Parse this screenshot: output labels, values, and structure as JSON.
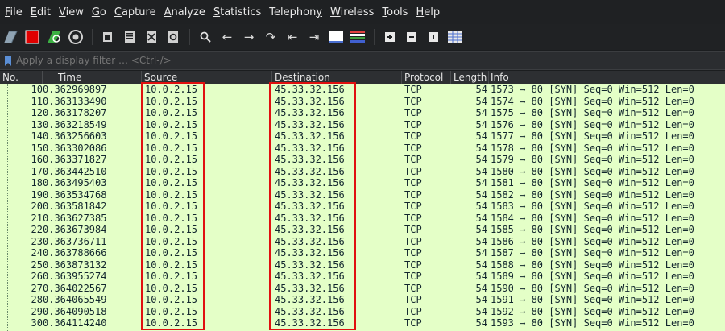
{
  "menu": [
    {
      "label": "File",
      "accel": "F",
      "rest": "ile"
    },
    {
      "label": "Edit",
      "accel": "E",
      "rest": "dit"
    },
    {
      "label": "View",
      "accel": "V",
      "rest": "iew"
    },
    {
      "label": "Go",
      "accel": "G",
      "rest": "o"
    },
    {
      "label": "Capture",
      "accel": "C",
      "rest": "apture"
    },
    {
      "label": "Analyze",
      "accel": "A",
      "rest": "nalyze"
    },
    {
      "label": "Statistics",
      "accel": "S",
      "rest": "tatistics"
    },
    {
      "label": "Telephony",
      "accel": "y",
      "rest": ""
    },
    {
      "label": "Wireless",
      "accel": "W",
      "rest": "ireless"
    },
    {
      "label": "Tools",
      "accel": "T",
      "rest": "ools"
    },
    {
      "label": "Help",
      "accel": "H",
      "rest": "elp"
    }
  ],
  "filter": {
    "placeholder": "Apply a display filter … <Ctrl-/>"
  },
  "columns": {
    "no": "No.",
    "time": "Time",
    "source": "Source",
    "destination": "Destination",
    "protocol": "Protocol",
    "length": "Length",
    "info": "Info"
  },
  "packets": [
    {
      "no": "10",
      "time": "0.362969897",
      "source": "10.0.2.15",
      "destination": "45.33.32.156",
      "protocol": "TCP",
      "length": "54",
      "info": "1573 → 80 [SYN] Seq=0 Win=512 Len=0"
    },
    {
      "no": "11",
      "time": "0.363133490",
      "source": "10.0.2.15",
      "destination": "45.33.32.156",
      "protocol": "TCP",
      "length": "54",
      "info": "1574 → 80 [SYN] Seq=0 Win=512 Len=0"
    },
    {
      "no": "12",
      "time": "0.363178207",
      "source": "10.0.2.15",
      "destination": "45.33.32.156",
      "protocol": "TCP",
      "length": "54",
      "info": "1575 → 80 [SYN] Seq=0 Win=512 Len=0"
    },
    {
      "no": "13",
      "time": "0.363218549",
      "source": "10.0.2.15",
      "destination": "45.33.32.156",
      "protocol": "TCP",
      "length": "54",
      "info": "1576 → 80 [SYN] Seq=0 Win=512 Len=0"
    },
    {
      "no": "14",
      "time": "0.363256603",
      "source": "10.0.2.15",
      "destination": "45.33.32.156",
      "protocol": "TCP",
      "length": "54",
      "info": "1577 → 80 [SYN] Seq=0 Win=512 Len=0"
    },
    {
      "no": "15",
      "time": "0.363302086",
      "source": "10.0.2.15",
      "destination": "45.33.32.156",
      "protocol": "TCP",
      "length": "54",
      "info": "1578 → 80 [SYN] Seq=0 Win=512 Len=0"
    },
    {
      "no": "16",
      "time": "0.363371827",
      "source": "10.0.2.15",
      "destination": "45.33.32.156",
      "protocol": "TCP",
      "length": "54",
      "info": "1579 → 80 [SYN] Seq=0 Win=512 Len=0"
    },
    {
      "no": "17",
      "time": "0.363442510",
      "source": "10.0.2.15",
      "destination": "45.33.32.156",
      "protocol": "TCP",
      "length": "54",
      "info": "1580 → 80 [SYN] Seq=0 Win=512 Len=0"
    },
    {
      "no": "18",
      "time": "0.363495403",
      "source": "10.0.2.15",
      "destination": "45.33.32.156",
      "protocol": "TCP",
      "length": "54",
      "info": "1581 → 80 [SYN] Seq=0 Win=512 Len=0"
    },
    {
      "no": "19",
      "time": "0.363534768",
      "source": "10.0.2.15",
      "destination": "45.33.32.156",
      "protocol": "TCP",
      "length": "54",
      "info": "1582 → 80 [SYN] Seq=0 Win=512 Len=0"
    },
    {
      "no": "20",
      "time": "0.363581842",
      "source": "10.0.2.15",
      "destination": "45.33.32.156",
      "protocol": "TCP",
      "length": "54",
      "info": "1583 → 80 [SYN] Seq=0 Win=512 Len=0"
    },
    {
      "no": "21",
      "time": "0.363627385",
      "source": "10.0.2.15",
      "destination": "45.33.32.156",
      "protocol": "TCP",
      "length": "54",
      "info": "1584 → 80 [SYN] Seq=0 Win=512 Len=0"
    },
    {
      "no": "22",
      "time": "0.363673984",
      "source": "10.0.2.15",
      "destination": "45.33.32.156",
      "protocol": "TCP",
      "length": "54",
      "info": "1585 → 80 [SYN] Seq=0 Win=512 Len=0"
    },
    {
      "no": "23",
      "time": "0.363736711",
      "source": "10.0.2.15",
      "destination": "45.33.32.156",
      "protocol": "TCP",
      "length": "54",
      "info": "1586 → 80 [SYN] Seq=0 Win=512 Len=0"
    },
    {
      "no": "24",
      "time": "0.363788666",
      "source": "10.0.2.15",
      "destination": "45.33.32.156",
      "protocol": "TCP",
      "length": "54",
      "info": "1587 → 80 [SYN] Seq=0 Win=512 Len=0"
    },
    {
      "no": "25",
      "time": "0.363873132",
      "source": "10.0.2.15",
      "destination": "45.33.32.156",
      "protocol": "TCP",
      "length": "54",
      "info": "1588 → 80 [SYN] Seq=0 Win=512 Len=0"
    },
    {
      "no": "26",
      "time": "0.363955274",
      "source": "10.0.2.15",
      "destination": "45.33.32.156",
      "protocol": "TCP",
      "length": "54",
      "info": "1589 → 80 [SYN] Seq=0 Win=512 Len=0"
    },
    {
      "no": "27",
      "time": "0.364022567",
      "source": "10.0.2.15",
      "destination": "45.33.32.156",
      "protocol": "TCP",
      "length": "54",
      "info": "1590 → 80 [SYN] Seq=0 Win=512 Len=0"
    },
    {
      "no": "28",
      "time": "0.364065549",
      "source": "10.0.2.15",
      "destination": "45.33.32.156",
      "protocol": "TCP",
      "length": "54",
      "info": "1591 → 80 [SYN] Seq=0 Win=512 Len=0"
    },
    {
      "no": "29",
      "time": "0.364090518",
      "source": "10.0.2.15",
      "destination": "45.33.32.156",
      "protocol": "TCP",
      "length": "54",
      "info": "1592 → 80 [SYN] Seq=0 Win=512 Len=0"
    },
    {
      "no": "30",
      "time": "0.364114240",
      "source": "10.0.2.15",
      "destination": "45.33.32.156",
      "protocol": "TCP",
      "length": "54",
      "info": "1593 → 80 [SYN] Seq=0 Win=512 Len=0"
    }
  ],
  "colors": {
    "row_bg": "#e4ffc7",
    "highlight": "#e01010",
    "stop_button": "#e00000",
    "restart_button": "#3cb043"
  },
  "toolbar_icons": [
    "shark-fin-icon",
    "stop-icon",
    "restart-capture-icon",
    "capture-options-icon",
    "open-file-icon",
    "save-file-icon",
    "close-file-icon",
    "reload-file-icon",
    "find-packet-icon",
    "go-back-icon",
    "go-forward-icon",
    "go-to-packet-icon",
    "go-first-icon",
    "go-last-icon",
    "auto-scroll-icon",
    "colorize-icon",
    "zoom-in-icon",
    "zoom-out-icon",
    "normal-size-icon",
    "resize-columns-icon"
  ]
}
